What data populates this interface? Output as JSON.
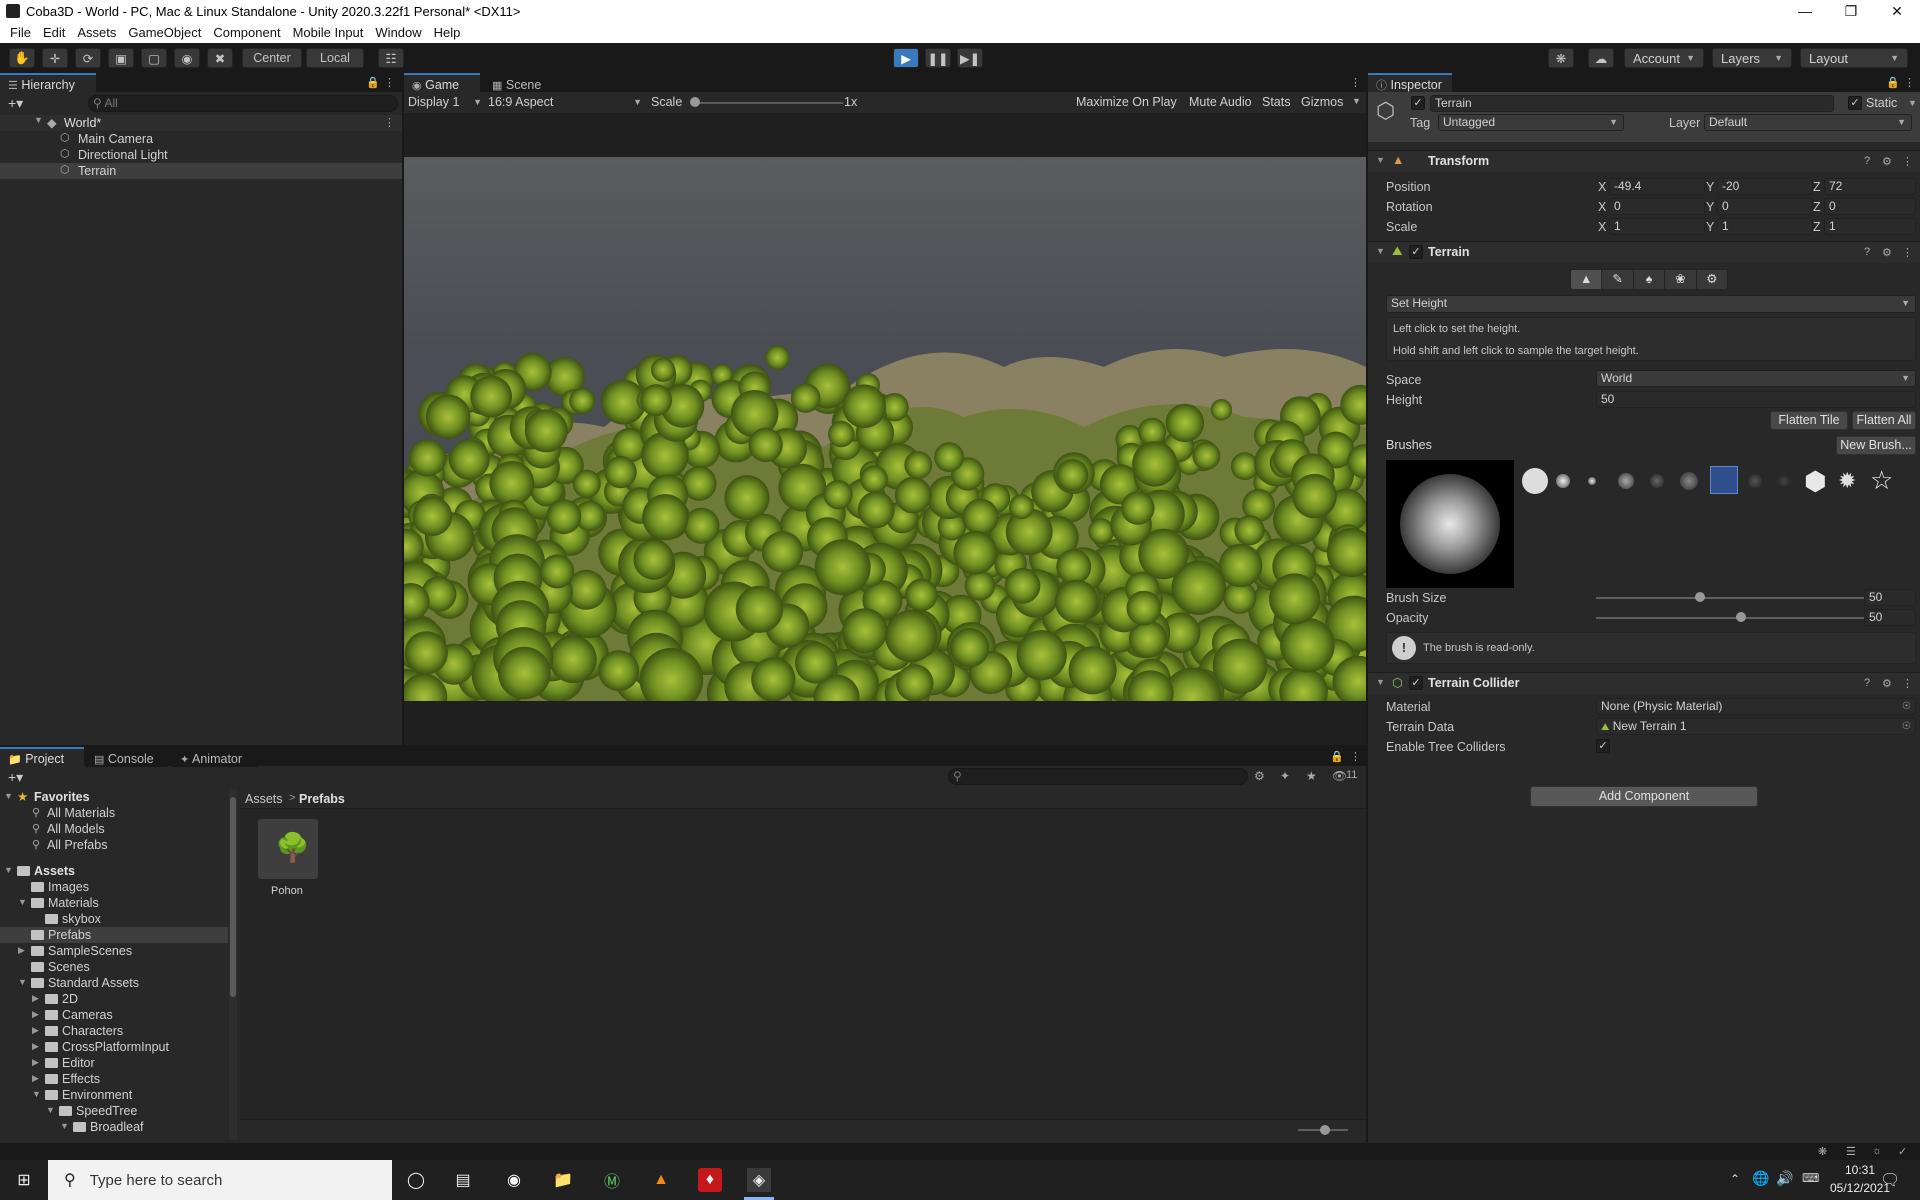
{
  "window": {
    "title": "Coba3D - World - PC, Mac & Linux Standalone - Unity 2020.3.22f1 Personal* <DX11>"
  },
  "menu": [
    "File",
    "Edit",
    "Assets",
    "GameObject",
    "Component",
    "Mobile Input",
    "Window",
    "Help"
  ],
  "toolbar": {
    "center": "Center",
    "local": "Local",
    "account": "Account",
    "layers": "Layers",
    "layout": "Layout"
  },
  "hierarchy": {
    "tab": "Hierarchy",
    "search_placeholder": "All",
    "scene": "World*",
    "items": [
      "Main Camera",
      "Directional Light",
      "Terrain"
    ]
  },
  "game": {
    "tab_game": "Game",
    "tab_scene": "Scene",
    "display": "Display 1",
    "aspect": "16:9 Aspect",
    "scale_label": "Scale",
    "scale_value": "1x",
    "maximize": "Maximize On Play",
    "mute": "Mute Audio",
    "stats": "Stats",
    "gizmos": "Gizmos"
  },
  "inspector": {
    "tab": "Inspector",
    "object_name": "Terrain",
    "static": "Static",
    "tag_label": "Tag",
    "tag_value": "Untagged",
    "layer_label": "Layer",
    "layer_value": "Default",
    "transform": {
      "title": "Transform",
      "position_label": "Position",
      "rotation_label": "Rotation",
      "scale_label": "Scale",
      "position": {
        "x": "-49.4",
        "y": "-20",
        "z": "72"
      },
      "rotation": {
        "x": "0",
        "y": "0",
        "z": "0"
      },
      "scale": {
        "x": "1",
        "y": "1",
        "z": "1"
      }
    },
    "terrain": {
      "title": "Terrain",
      "mode": "Set Height",
      "help1": "Left click to set the height.",
      "help2": "Hold shift and left click to sample the target height.",
      "space_label": "Space",
      "space_value": "World",
      "height_label": "Height",
      "height_value": "50",
      "flatten_tile": "Flatten Tile",
      "flatten_all": "Flatten All",
      "brushes_label": "Brushes",
      "new_brush": "New Brush...",
      "brush_size_label": "Brush Size",
      "brush_size_value": "50",
      "brush_size_level": 0.36,
      "opacity_label": "Opacity",
      "opacity_value": "50",
      "opacity_level": 0.5,
      "readonly_note": "The brush is read-only."
    },
    "collider": {
      "title": "Terrain Collider",
      "material_label": "Material",
      "material_value": "None (Physic Material)",
      "data_label": "Terrain Data",
      "data_value": "New Terrain 1",
      "trees_label": "Enable Tree Colliders"
    },
    "add_component": "Add Component"
  },
  "project": {
    "tab_project": "Project",
    "tab_console": "Console",
    "tab_animator": "Animator",
    "hidden_count": "11",
    "favorites": "Favorites",
    "fav_items": [
      "All Materials",
      "All Models",
      "All Prefabs"
    ],
    "assets": "Assets",
    "tree": [
      {
        "label": "Images",
        "indent": 1
      },
      {
        "label": "Materials",
        "indent": 1
      },
      {
        "label": "skybox",
        "indent": 2
      },
      {
        "label": "Prefabs",
        "indent": 1
      },
      {
        "label": "SampleScenes",
        "indent": 1
      },
      {
        "label": "Scenes",
        "indent": 1
      },
      {
        "label": "Standard Assets",
        "indent": 1
      },
      {
        "label": "2D",
        "indent": 2
      },
      {
        "label": "Cameras",
        "indent": 2
      },
      {
        "label": "Characters",
        "indent": 2
      },
      {
        "label": "CrossPlatformInput",
        "indent": 2
      },
      {
        "label": "Editor",
        "indent": 2
      },
      {
        "label": "Effects",
        "indent": 2
      },
      {
        "label": "Environment",
        "indent": 2
      },
      {
        "label": "SpeedTree",
        "indent": 3
      },
      {
        "label": "Broadleaf",
        "indent": 4
      }
    ],
    "breadcrumb_root": "Assets",
    "breadcrumb_current": "Prefabs",
    "asset_name": "Pohon"
  },
  "taskbar": {
    "search_placeholder": "Type here to search",
    "time": "10:31",
    "date": "05/12/2021"
  },
  "colors": {
    "accent": "#3a79bb",
    "play_active": "#3a79bb",
    "sky": "#5a5d62",
    "foliage": "#7aa02a"
  }
}
